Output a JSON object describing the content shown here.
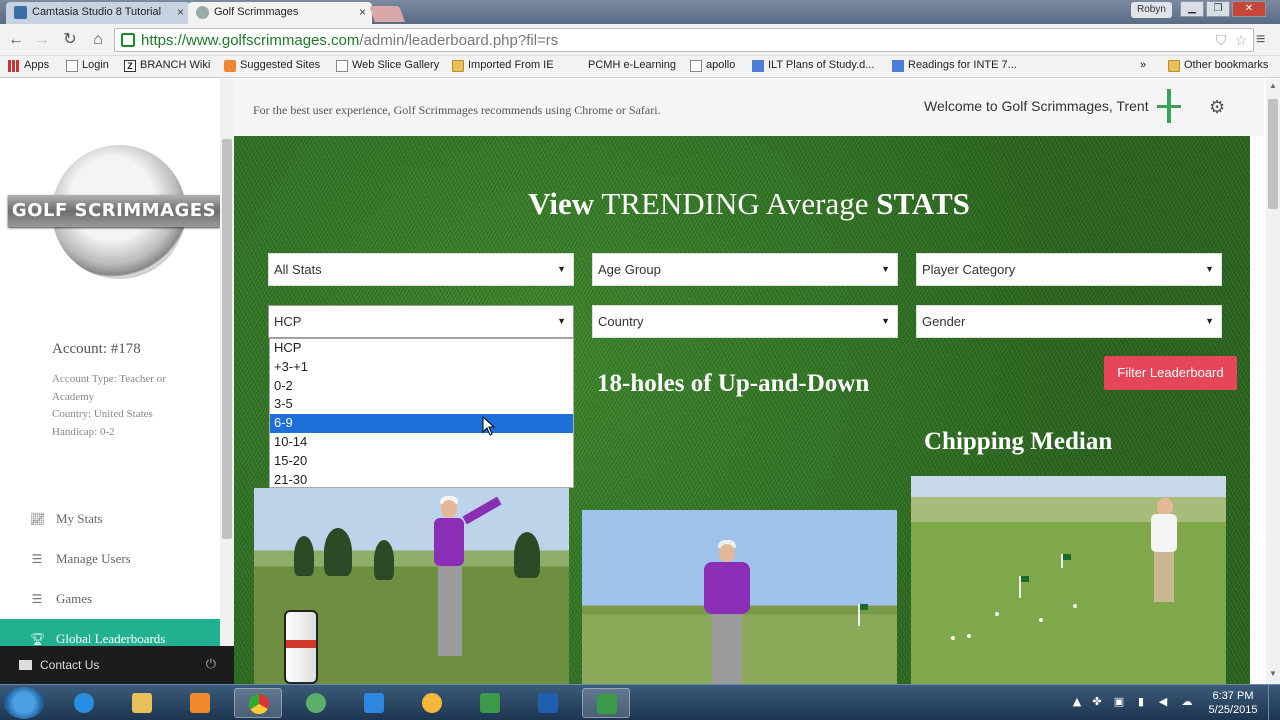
{
  "browser": {
    "tabs": [
      {
        "label": "Camtasia Studio 8 Tutorial",
        "active": false
      },
      {
        "label": "Golf Scrimmages",
        "active": true
      }
    ],
    "user": "Robyn",
    "url": {
      "host": "https://www.golfscrimmages.com",
      "path": "/admin/leaderboard.php?fil=rs"
    },
    "bookmarks": [
      {
        "label": "Apps",
        "icon": "apps-icon"
      },
      {
        "label": "Login",
        "icon": "page-icon"
      },
      {
        "label": "BRANCH Wiki",
        "icon": "z-icon"
      },
      {
        "label": "Suggested Sites",
        "icon": "suggested-icon"
      },
      {
        "label": "Web Slice Gallery",
        "icon": "page-icon"
      },
      {
        "label": "Imported From IE",
        "icon": "folder-icon"
      },
      {
        "label": "PCMH e-Learning",
        "icon": ""
      },
      {
        "label": "apollo",
        "icon": "page-icon"
      },
      {
        "label": "ILT Plans of Study.d...",
        "icon": "doc-icon"
      },
      {
        "label": "Readings for INTE 7...",
        "icon": "doc-icon"
      }
    ],
    "bookmarks_overflow": "»",
    "other_bookmarks": "Other bookmarks"
  },
  "sidebar": {
    "logo_text": "GOLF SCRIMMAGES",
    "account": "Account: #178",
    "account_info": [
      "Account Type: Teacher or Academy",
      "Country: United States",
      "Handicap: 0-2"
    ],
    "nav": [
      {
        "label": "My Stats",
        "icon": "chart-icon",
        "active": false
      },
      {
        "label": "Manage Users",
        "icon": "list-icon",
        "active": false
      },
      {
        "label": "Games",
        "icon": "list-icon",
        "active": false
      },
      {
        "label": "Global Leaderboards",
        "icon": "trophy-icon",
        "active": true
      }
    ],
    "contact": "Contact Us"
  },
  "topbar": {
    "notice": "For the best user experience, Golf Scrimmages recommends using Chrome or Safari.",
    "welcome": "Welcome to Golf Scrimmages, Trent"
  },
  "main": {
    "heading_pre": "View",
    "heading_mid": "TRENDING Average",
    "heading_post": "STATS",
    "filters": {
      "stats": "All Stats",
      "age": "Age Group",
      "category": "Player Category",
      "hcp": "HCP",
      "country": "Country",
      "gender": "Gender"
    },
    "hcp_options": [
      "HCP",
      "+3-+1",
      "0-2",
      "3-5",
      "6-9",
      "10-14",
      "15-20",
      "21-30"
    ],
    "hcp_highlighted": "6-9",
    "filter_button": "Filter Leaderboard",
    "cards": [
      {
        "title": "18-holes of Up-and-Down"
      },
      {
        "title": "Chipping Median"
      }
    ]
  },
  "taskbar": {
    "time": "6:37 PM",
    "date": "5/25/2015"
  },
  "colors": {
    "accent": "#21b191",
    "filter_button": "#e5465a",
    "selection": "#1e6fd9"
  }
}
